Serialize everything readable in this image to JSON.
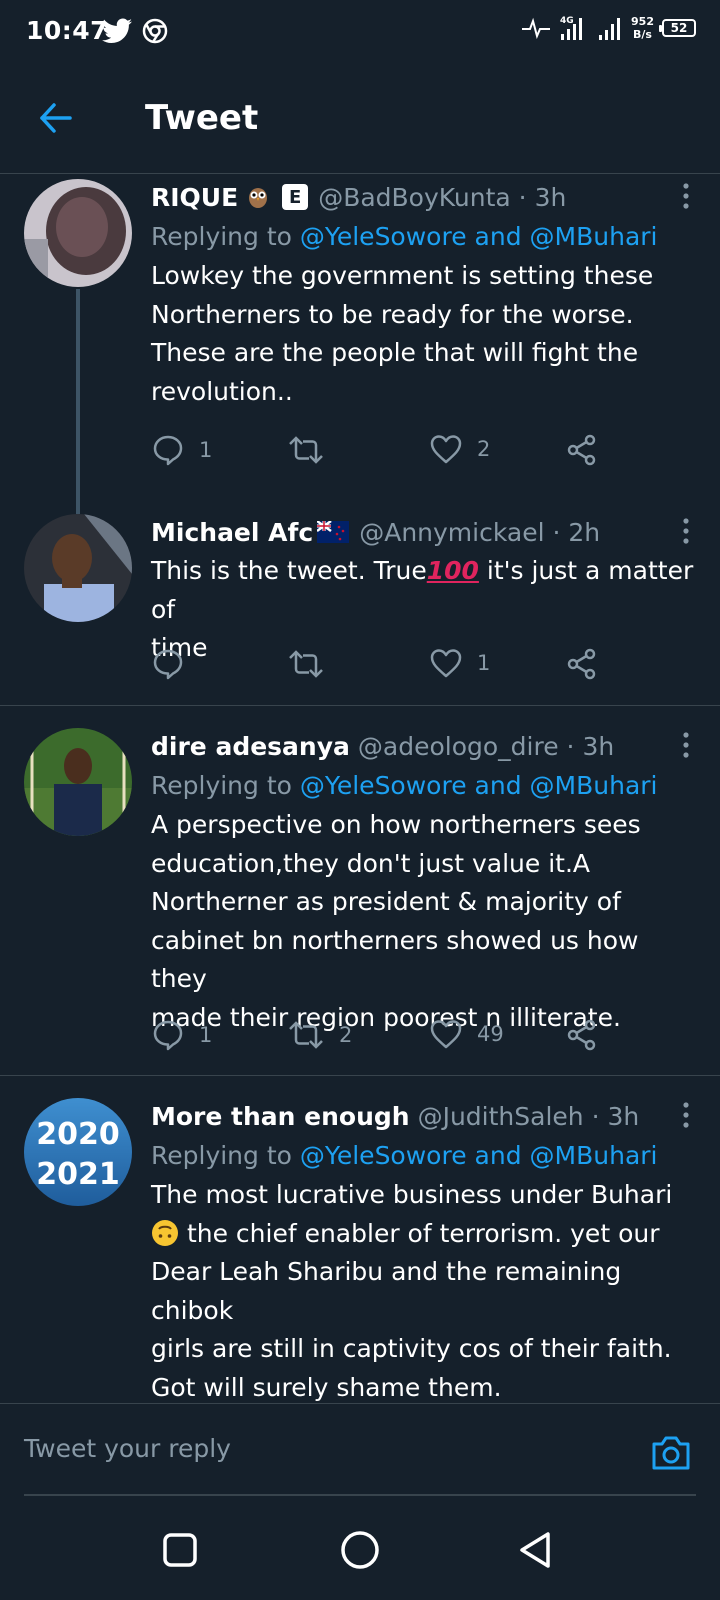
{
  "status_bar": {
    "time": "10:47",
    "net_speed_value": "952",
    "net_speed_unit": "B/s",
    "network_type": "4G",
    "battery": "52"
  },
  "header": {
    "title": "Tweet",
    "back_icon": "arrow-left-icon"
  },
  "colors": {
    "background": "#15202b",
    "accent": "#1da1f2",
    "secondary_text": "#8899a6",
    "divider": "#38444d"
  },
  "tweets": [
    {
      "name": "RIQUE",
      "name_emoji": "owl",
      "badge": "E",
      "handle": "@BadBoyKunta",
      "time": "3h",
      "replying_label": "Replying to",
      "mention1": "@YeleSowore",
      "and": "and",
      "mention2": "@MBuhari",
      "text_lines": [
        "Lowkey the government is setting these",
        "Northerners to be ready for the worse.",
        "These are the people that will fight the",
        "revolution.."
      ],
      "replies": "1",
      "retweets": "",
      "likes": "2"
    },
    {
      "name": "Michael Afc",
      "name_emoji": "new-zealand-flag",
      "handle": "@Annymickael",
      "time": "2h",
      "text_line1": "This is the tweet. True",
      "text_emoji": "100",
      "text_line1_end": " it's just a matter of",
      "text_line2": "time",
      "replies": "",
      "retweets": "",
      "likes": "1"
    },
    {
      "name": "dire adesanya",
      "handle": "@adeologo_dire",
      "time": "3h",
      "replying_label": "Replying to",
      "mention1": "@YeleSowore",
      "and": "and",
      "mention2": "@MBuhari",
      "text_lines": [
        "A perspective on how northerners sees",
        "education,they don't just value it.A",
        "Northerner as president & majority of",
        "cabinet bn northerners showed us how they",
        "made their region poorest n illiterate."
      ],
      "replies": "1",
      "retweets": "2",
      "likes": "49"
    },
    {
      "name": "More than enough",
      "handle": "@JudithSaleh",
      "time": "3h",
      "replying_label": "Replying to",
      "mention1": "@YeleSowore",
      "and": "and",
      "mention2": "@MBuhari",
      "text_line1": "The most lucrative business under Buhari",
      "text_line2_end": " the chief enabler of terrorism. yet our",
      "text_lines_rest": [
        "Dear Leah Sharibu and the remaining chibok",
        "girls are still in captivity cos of their faith.",
        "Got will surely shame them."
      ],
      "avatar_text_top": "2020",
      "avatar_text_bottom": "2021"
    }
  ],
  "reply_bar": {
    "placeholder": "Tweet your reply",
    "camera_icon": "camera-icon"
  },
  "nav_bar": {
    "icons": [
      "recent-apps-icon",
      "home-icon",
      "back-icon"
    ]
  }
}
